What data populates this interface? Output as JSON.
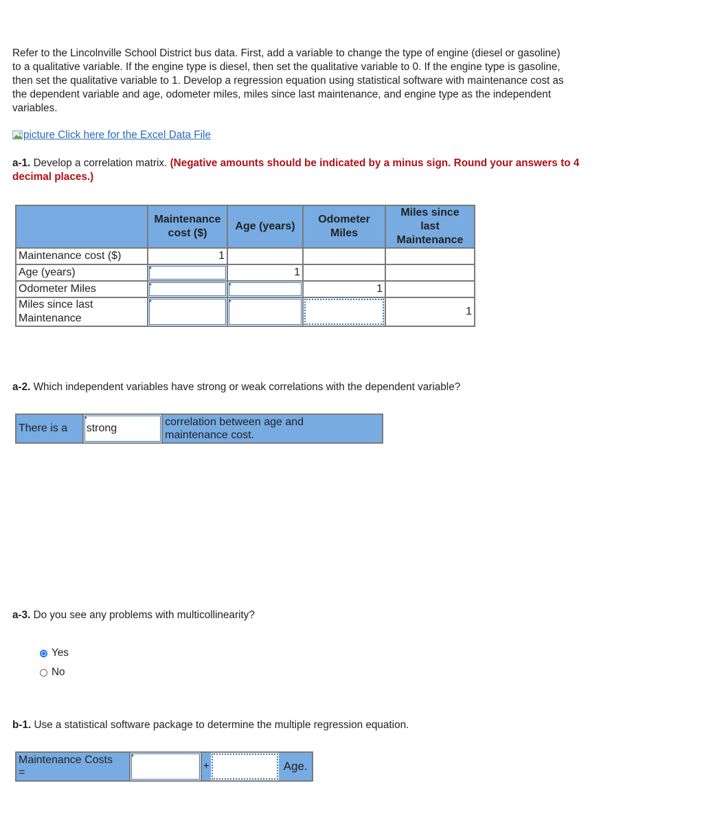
{
  "intro": {
    "lines": [
      "Refer to the Lincolnville School District bus data. First, add a variable to change the type of engine (diesel or gasoline)",
      "to a qualitative variable. If the engine type is diesel, then set the qualitative variable to 0. If the engine type is gasoline,",
      "then set the qualitative variable to 1. Develop a regression equation using statistical software with maintenance cost as",
      "the dependent variable and age, odometer miles, miles since last maintenance, and engine type as the independent",
      "variables."
    ]
  },
  "data_link": {
    "alt_text": "picture",
    "label": "Click here for the Excel Data File"
  },
  "a1": {
    "label": "a-1.",
    "text": "Develop a correlation matrix.",
    "instruction_line1": "(Negative amounts should be indicated by a minus sign. Round your answers to 4",
    "instruction_line2": "decimal places.)",
    "table": {
      "headers": [
        "",
        "Maintenance cost ($)",
        "Age (years)",
        "Odometer Miles",
        "Miles since last Maintenance"
      ],
      "header_lines": {
        "maintenance": [
          "Maintenance",
          "cost ($)"
        ],
        "age": [
          "Age (years)"
        ],
        "odometer": [
          "Odometer",
          "Miles"
        ],
        "miles_since": [
          "Miles since",
          "last",
          "Maintenance"
        ]
      },
      "rows": [
        {
          "label": "Maintenance cost ($)",
          "cells": [
            "1",
            "",
            "",
            ""
          ]
        },
        {
          "label": "Age (years)",
          "cells": [
            "",
            "1",
            "",
            ""
          ]
        },
        {
          "label": "Odometer Miles",
          "cells": [
            "",
            "",
            "1",
            ""
          ]
        },
        {
          "label_lines": [
            "Miles since last",
            "Maintenance"
          ],
          "cells": [
            "",
            "",
            "",
            "1"
          ]
        }
      ]
    }
  },
  "a2": {
    "label": "a-2.",
    "text": "Which independent variables have strong or weak correlations with the dependent variable?",
    "prefix": "There is a",
    "selected": "strong",
    "suffix_line1": "correlation between age and",
    "suffix_line2": "maintenance cost."
  },
  "a3": {
    "label": "a-3.",
    "text": "Do you see any problems with multicollinearity?",
    "options": [
      {
        "label": "Yes",
        "checked": true
      },
      {
        "label": "No",
        "checked": false
      }
    ]
  },
  "b1": {
    "label": "b-1.",
    "text": "Use a statistical software package to determine the multiple regression equation.",
    "lhs_line1": "Maintenance Costs",
    "lhs_line2": "=",
    "intercept_value": "",
    "plus": "+",
    "age_coef_value": "",
    "term_label": "Age."
  },
  "colors": {
    "header_blue": "#77abe2",
    "instruction_red": "#b01117",
    "link_blue": "#2a6ab5",
    "radio_blue": "#1a73e8"
  }
}
